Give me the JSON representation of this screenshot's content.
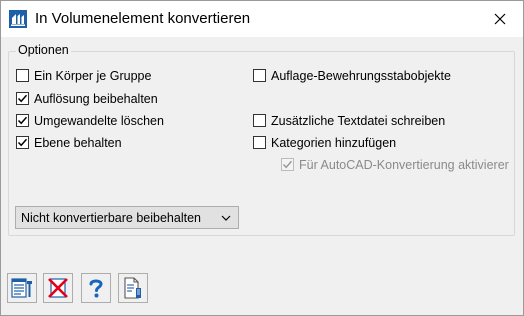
{
  "window": {
    "title": "In Volumenelement konvertieren"
  },
  "options": {
    "legend": "Optionen",
    "left": [
      {
        "label": "Ein Körper je Gruppe",
        "checked": false
      },
      {
        "label": "Auflösung beibehalten",
        "checked": true
      },
      {
        "label": "Umgewandelte löschen",
        "checked": true
      },
      {
        "label": "Ebene behalten",
        "checked": true
      }
    ],
    "right": [
      {
        "label": "Auflage-Bewehrungsstabobjekte",
        "checked": false
      },
      {
        "label": "Zusätzliche Textdatei schreiben",
        "checked": false
      },
      {
        "label": "Kategorien hinzufügen",
        "checked": false
      },
      {
        "label": "Für AutoCAD-Konvertierung aktivierer",
        "checked": true,
        "disabled": true
      }
    ]
  },
  "dropdown": {
    "selected": "Nicht konvertierbare beibehalten"
  },
  "toolbar": {
    "buttons": [
      "ok-icon",
      "cancel-icon",
      "help-icon",
      "info-icon"
    ]
  },
  "colors": {
    "cancel_red": "#e2001a",
    "help_blue": "#1565c0",
    "icon_blue": "#1f5fa8"
  }
}
